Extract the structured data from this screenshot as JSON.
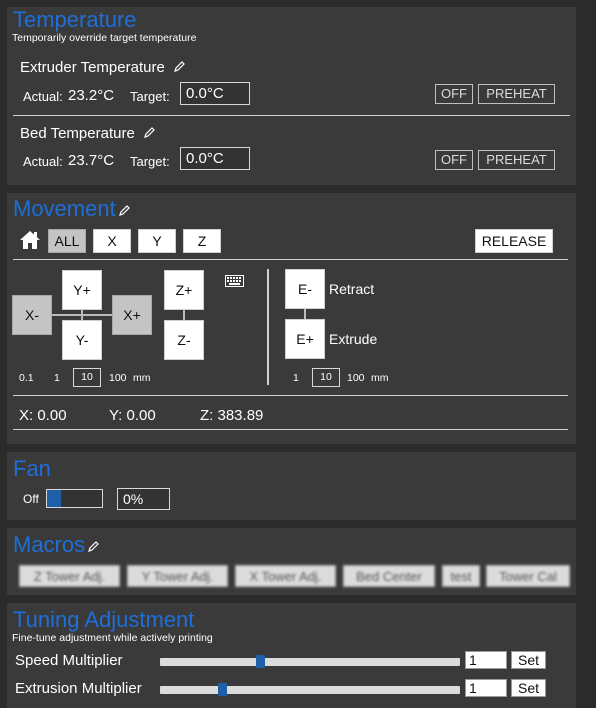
{
  "temperature": {
    "title": "Temperature",
    "subtitle": "Temporarily override target temperature",
    "extruder": {
      "label": "Extruder Temperature",
      "actual_label": "Actual:",
      "actual_value": "23.2°C",
      "target_label": "Target:",
      "target_value": "0.0°C",
      "off_label": "OFF",
      "preheat_label": "PREHEAT"
    },
    "bed": {
      "label": "Bed Temperature",
      "actual_label": "Actual:",
      "actual_value": "23.7°C",
      "target_label": "Target:",
      "target_value": "0.0°C",
      "off_label": "OFF",
      "preheat_label": "PREHEAT"
    }
  },
  "movement": {
    "title": "Movement",
    "home_icon": "home-icon",
    "axis_buttons": [
      "ALL",
      "X",
      "Y",
      "Z"
    ],
    "release_label": "RELEASE",
    "jog": {
      "y_plus": "Y+",
      "y_minus": "Y-",
      "x_minus": "X-",
      "x_plus": "X+",
      "z_plus": "Z+",
      "z_minus": "Z-",
      "e_minus": "E-",
      "e_plus": "E+",
      "retract_label": "Retract",
      "extrude_label": "Extrude"
    },
    "keyboard_icon": "keyboard-icon",
    "xy_steps": [
      "0.1",
      "1",
      "10",
      "100",
      "mm"
    ],
    "xy_selected_step": "10",
    "e_steps": [
      "1",
      "10",
      "100",
      "mm"
    ],
    "e_selected_step": "10",
    "position": {
      "x": "X: 0.00",
      "y": "Y: 0.00",
      "z": "Z: 383.89"
    }
  },
  "fan": {
    "title": "Fan",
    "off_label": "Off",
    "value": "0%",
    "level": 0
  },
  "macros": {
    "title": "Macros",
    "buttons": [
      "Z Tower Adj.",
      "Y Tower Adj.",
      "X Tower Adj.",
      "Bed Center",
      "test",
      "Tower Cal"
    ]
  },
  "tuning": {
    "title": "Tuning Adjustment",
    "subtitle": "Fine-tune adjustment while actively printing",
    "speed": {
      "label": "Speed Multiplier",
      "value": "1",
      "set_label": "Set",
      "level": 0.33
    },
    "extrusion": {
      "label": "Extrusion Multiplier",
      "value": "1",
      "set_label": "Set",
      "level": 0.2
    }
  },
  "colors": {
    "accent": "#1e6fd9",
    "panel": "#3a3a3a",
    "background": "#2b2b2b",
    "slider_thumb": "#1f5fa8"
  }
}
